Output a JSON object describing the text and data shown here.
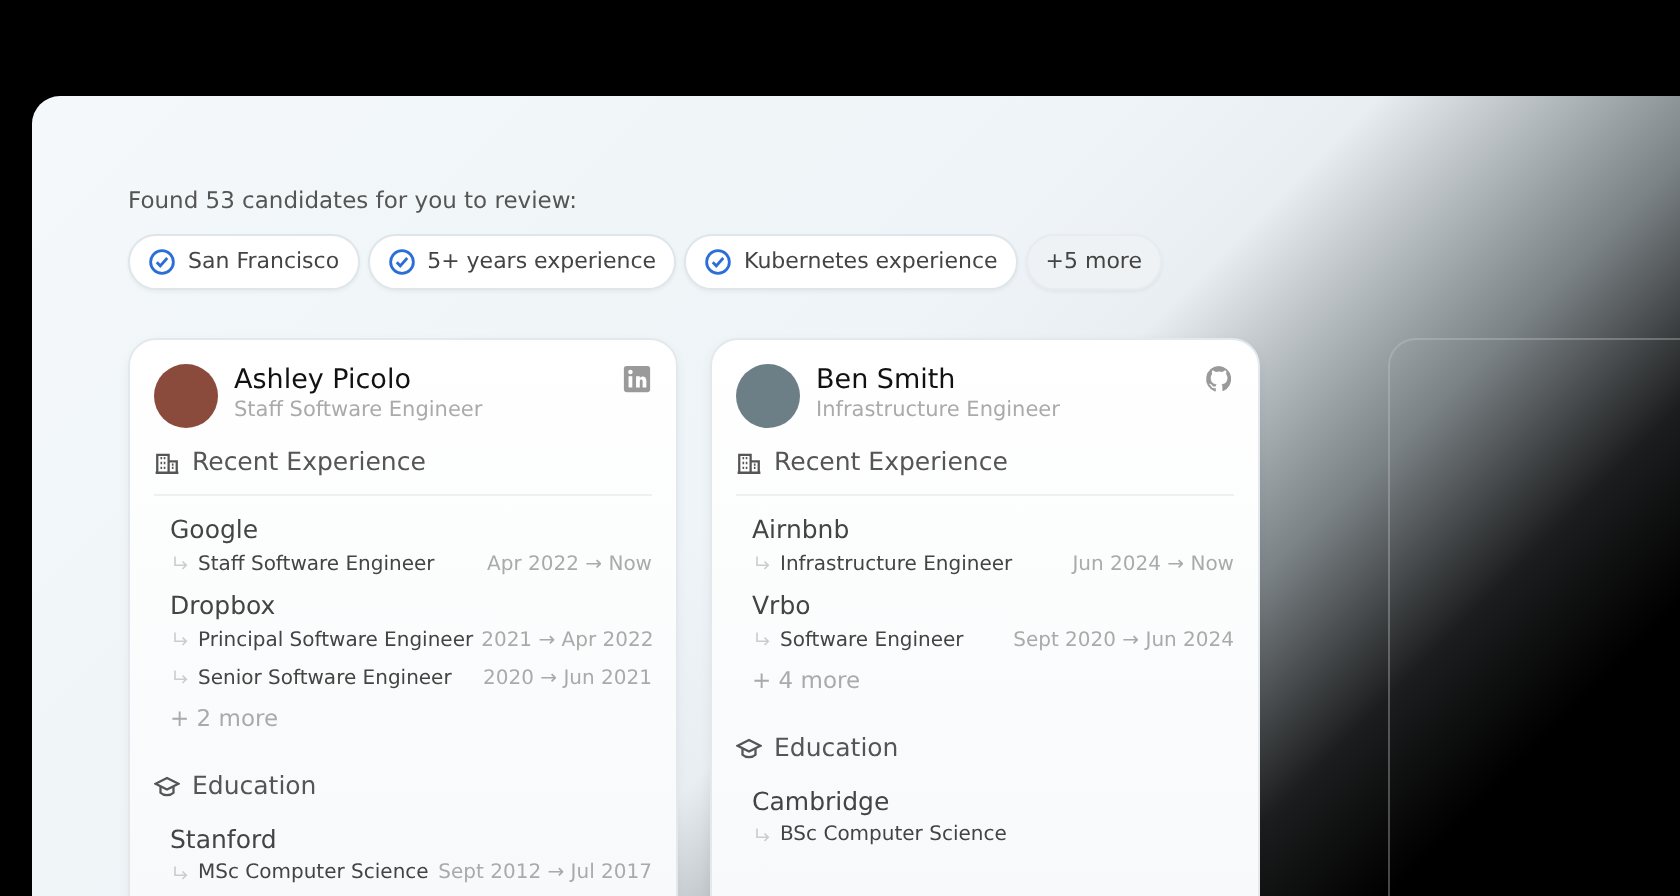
{
  "summary": "Found 53 candidates for you to review:",
  "filters": [
    {
      "label": "San Francisco",
      "checked": true
    },
    {
      "label": "5+ years experience",
      "checked": true
    },
    {
      "label": "Kubernetes experience",
      "checked": true
    },
    {
      "label": "+5 more",
      "checked": false
    }
  ],
  "candidates": [
    {
      "name": "Ashley Picolo",
      "title": "Staff Software Engineer",
      "kind": "linkedin",
      "experience_heading": "Recent Experience",
      "experience": [
        {
          "company": "Google",
          "roles": [
            {
              "role": "Staff Software Engineer",
              "dates": "Apr 2022 → Now"
            }
          ]
        },
        {
          "company": "Dropbox",
          "roles": [
            {
              "role": "Principal Software Engineer",
              "dates": "2021 → Apr 2022"
            },
            {
              "role": "Senior Software Engineer",
              "dates": "2020 → Jun 2021"
            }
          ]
        }
      ],
      "more": "+ 2 more",
      "education_heading": "Education",
      "education": [
        {
          "school": "Stanford",
          "degree": "MSc Computer Science",
          "dates": "Sept 2012 → Jul 2017"
        }
      ]
    },
    {
      "name": "Ben Smith",
      "title": "Infrastructure Engineer",
      "kind": "github",
      "experience_heading": "Recent Experience",
      "experience": [
        {
          "company": "Airnbnb",
          "roles": [
            {
              "role": "Infrastructure Engineer",
              "dates": "Jun 2024 → Now"
            }
          ]
        },
        {
          "company": "Vrbo",
          "roles": [
            {
              "role": "Software Engineer",
              "dates": "Sept 2020 → Jun 2024"
            }
          ]
        }
      ],
      "more": "+ 4 more",
      "education_heading": "Education",
      "education": [
        {
          "school": "Cambridge",
          "degree": "BSc Computer Science"
        }
      ]
    }
  ]
}
